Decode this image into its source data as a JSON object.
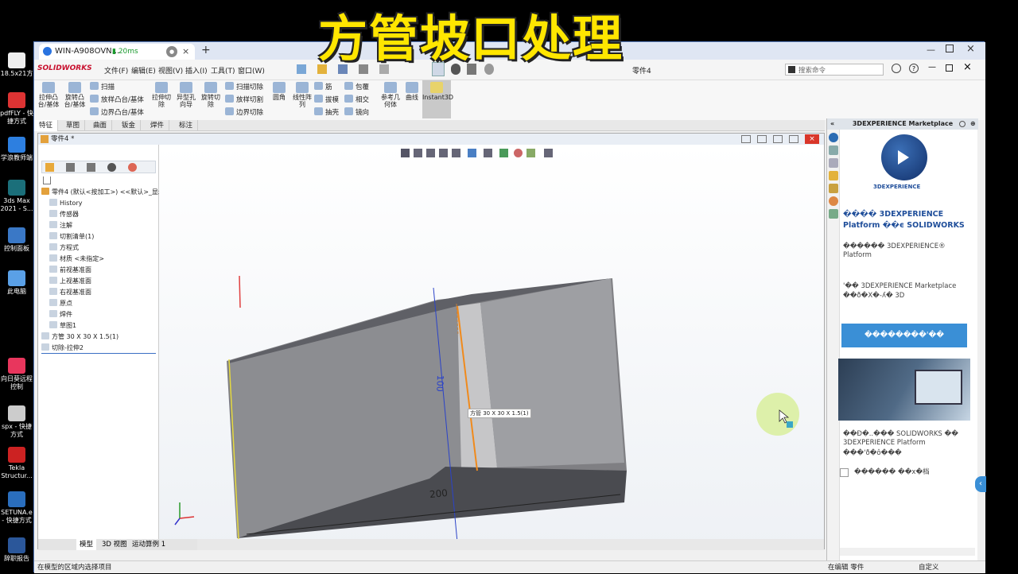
{
  "overlay_title": "方管坡口处理",
  "desktop_icons": [
    {
      "label": "18.5x21方"
    },
    {
      "label": "pdfFLY - 快捷方式"
    },
    {
      "label": "学浪教师端"
    },
    {
      "label": "3ds Max 2021 - S..."
    },
    {
      "label": "控制面板"
    },
    {
      "label": "此电脑"
    },
    {
      "label": "向日葵远程控制"
    },
    {
      "label": "spx - 快捷方式"
    },
    {
      "label": "Tekla Structur..."
    },
    {
      "label": "SETUNA.e - 快捷方式"
    },
    {
      "label": "辞职报告"
    }
  ],
  "browser": {
    "tab_title": "WIN-A908OVN...",
    "ping": "20ms",
    "new_tab": "+"
  },
  "sw": {
    "logo": "SOLIDWORKS",
    "menus": [
      "文件(F)",
      "编辑(E)",
      "视图(V)",
      "插入(I)",
      "工具(T)",
      "窗口(W)"
    ],
    "doc_name": "零件4",
    "search_placeholder": "搜索命令",
    "cmd_large": [
      {
        "label": "拉伸凸台/基体"
      },
      {
        "label": "旋转凸台/基体"
      },
      {
        "label": "拉伸切除"
      },
      {
        "label": "异型孔向导"
      },
      {
        "label": "旋转切除"
      },
      {
        "label": "圆角"
      },
      {
        "label": "线性阵列"
      },
      {
        "label": "参考几何体"
      },
      {
        "label": "曲线"
      },
      {
        "label": "Instant3D"
      }
    ],
    "cmd_small": [
      {
        "label": "扫描"
      },
      {
        "label": "放样凸台/基体"
      },
      {
        "label": "边界凸台/基体"
      },
      {
        "label": "扫描切除"
      },
      {
        "label": "放样切割"
      },
      {
        "label": "边界切除"
      },
      {
        "label": "筋"
      },
      {
        "label": "拔模"
      },
      {
        "label": "抽壳"
      },
      {
        "label": "包覆"
      },
      {
        "label": "相交"
      },
      {
        "label": "镜向"
      }
    ],
    "cmd_tabs": [
      "特征",
      "草图",
      "曲面",
      "钣金",
      "焊件",
      "标注"
    ],
    "doc_title": "零件4 *",
    "feature_tree": [
      {
        "label": "零件4 (默认<按加工>) <<默认>_显示状"
      },
      {
        "label": "History"
      },
      {
        "label": "传感器"
      },
      {
        "label": "注解"
      },
      {
        "label": "切割清单(1)"
      },
      {
        "label": "方程式"
      },
      {
        "label": "材质 <未指定>"
      },
      {
        "label": "前视基准面"
      },
      {
        "label": "上视基准面"
      },
      {
        "label": "右视基准面"
      },
      {
        "label": "原点"
      },
      {
        "label": "焊件"
      },
      {
        "label": "草图1"
      },
      {
        "label": "方管 30 X 30 X 1.5(1)"
      },
      {
        "label": "切除-拉伸2"
      }
    ],
    "bottom_tabs": [
      "模型",
      "3D 视图",
      "运动算例 1"
    ],
    "dim_100": "100",
    "dim_200": "200",
    "tooltip": "方管 30 X 30 X 1.5(1)",
    "status_left": "在模型的区域内选择项目",
    "status_mid": "在编辑 零件",
    "status_right": "自定义"
  },
  "task_pane": {
    "header": "3DEXPERIENCE Marketplace",
    "logo_text": "3DEXPERIENCE",
    "heading": "���� 3DEXPERIENCE Platform ��ϵ SOLIDWORKS",
    "para1": "������ 3DEXPERIENCE® Platform",
    "para2": "'�� 3DEXPERIENCE Marketplace",
    "para3": "��ð�X�-ʎ� 3D",
    "button_label": "��������'��",
    "caption": "��Ð�..��� SOLIDWORKS �� 3DEXPERIENCE Platform",
    "caption2": "���'ð�ô���",
    "checkbox_label": "������ ��x�档"
  },
  "colors": {
    "overlay_text": "#ffe600",
    "accent_blue": "#3a8fd6",
    "orange_edge": "#f08a1c"
  }
}
